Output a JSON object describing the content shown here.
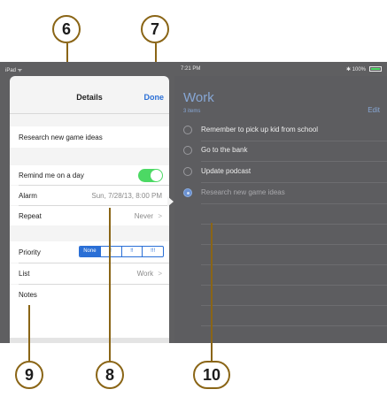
{
  "status": {
    "left": "iPad ᯤ",
    "time": "7:21 PM",
    "right": "✱ 100%"
  },
  "details": {
    "title": "Details",
    "done_label": "Done",
    "task_title": "Research new game ideas",
    "remind_label": "Remind me on a day",
    "remind_on": true,
    "alarm_label": "Alarm",
    "alarm_value": "Sun, 7/28/13, 8:00 PM",
    "repeat_label": "Repeat",
    "repeat_value": "Never",
    "priority_label": "Priority",
    "priority_options": [
      "None",
      "!",
      "!!",
      "!!!"
    ],
    "priority_selected": "None",
    "list_label": "List",
    "list_value": "Work",
    "notes_label": "Notes",
    "chevron": ">"
  },
  "work": {
    "title": "Work",
    "count": "3 items",
    "edit_label": "Edit",
    "items": [
      {
        "text": "Remember to pick up kid from school",
        "selected": false
      },
      {
        "text": "Go to the bank",
        "selected": false
      },
      {
        "text": "Update podcast",
        "selected": false
      },
      {
        "text": "Research new game ideas",
        "selected": true
      }
    ]
  },
  "callouts": [
    "6",
    "7",
    "8",
    "9",
    "10"
  ],
  "colors": {
    "accent": "#2a6fd6",
    "toggle_on": "#4cd964",
    "callout_border": "#8a6516",
    "work_text": "#87a7d5"
  }
}
